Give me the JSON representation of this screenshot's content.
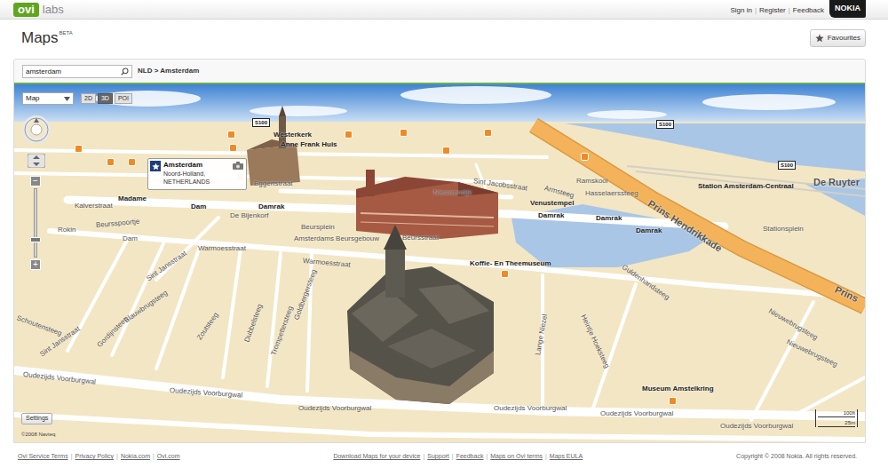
{
  "brand": {
    "logo": "ovi",
    "sub": "labs"
  },
  "account": {
    "links": [
      "Sign in",
      "Register",
      "Feedback"
    ],
    "separator": "|"
  },
  "nokia": "NOKIA",
  "page": {
    "title": "Maps",
    "badge": "BETA"
  },
  "favourites": {
    "label": "Favourites"
  },
  "search": {
    "value": "amsterdam"
  },
  "breadcrumb": "NLD > Amsterdam",
  "map": {
    "view_select": "Map",
    "view_modes": [
      {
        "label": "2D",
        "selected": false
      },
      {
        "label": "3D",
        "selected": true
      },
      {
        "label": "POI",
        "selected": false
      }
    ],
    "zoom": {
      "out": "−",
      "in": "+",
      "level": 0.25
    },
    "popup": {
      "title": "Amsterdam",
      "lines": [
        "Noord-Holland,",
        "NETHERLANDS"
      ]
    },
    "road_shields": [
      "S100",
      "S100",
      "S100"
    ],
    "labels": [
      {
        "text": "Kalverstraat",
        "kind": "street"
      },
      {
        "text": "Madame",
        "kind": "place"
      },
      {
        "text": "Dam",
        "kind": "place"
      },
      {
        "text": "Damrak",
        "kind": "place"
      },
      {
        "text": "De Bijenkorf",
        "kind": "street"
      },
      {
        "text": "Rokin",
        "kind": "street"
      },
      {
        "text": "Beursspoortje",
        "kind": "street"
      },
      {
        "text": "Dam",
        "kind": "street"
      },
      {
        "text": "Beursplein",
        "kind": "street"
      },
      {
        "text": "Amsterdams Beursgebouw",
        "kind": "street"
      },
      {
        "text": "Beursstraat",
        "kind": "street"
      },
      {
        "text": "Warmoesstraat",
        "kind": "street"
      },
      {
        "text": "Warmoesstraat",
        "kind": "street"
      },
      {
        "text": "Sint Jansstraat",
        "kind": "street"
      },
      {
        "text": "Schoutensteeg",
        "kind": "street"
      },
      {
        "text": "Sint Jansstraat",
        "kind": "street"
      },
      {
        "text": "Gordijnsteeg",
        "kind": "street"
      },
      {
        "text": "Blauwbrugsteeg",
        "kind": "street"
      },
      {
        "text": "Zoutsteeg",
        "kind": "street"
      },
      {
        "text": "Dubbelsteeg",
        "kind": "street"
      },
      {
        "text": "Trompettersteeg",
        "kind": "street"
      },
      {
        "text": "Goldbergersteeg",
        "kind": "street"
      },
      {
        "text": "Koffie- En Theemuseum",
        "kind": "place"
      },
      {
        "text": "Guldenhandsteeg",
        "kind": "street"
      },
      {
        "text": "Lange Niezel",
        "kind": "street"
      },
      {
        "text": "Heintje Hoeksteeg",
        "kind": "street"
      },
      {
        "text": "Oudezijds Voorburgwal",
        "kind": "street"
      },
      {
        "text": "Oudezijds Voorburgwal",
        "kind": "street"
      },
      {
        "text": "Oudezijds Voorburgwal",
        "kind": "street"
      },
      {
        "text": "Oudezijds Voorburgwal",
        "kind": "street"
      },
      {
        "text": "Oudezijds Voorburgwal",
        "kind": "street"
      },
      {
        "text": "Oudezijds Voorburgwal",
        "kind": "street"
      },
      {
        "text": "Museum Amstelkring",
        "kind": "place"
      },
      {
        "text": "Nieuwebrugsteeg",
        "kind": "street"
      },
      {
        "text": "Nieuwebrugsteeg",
        "kind": "street"
      },
      {
        "text": "Prins Hendrikkade",
        "kind": "major"
      },
      {
        "text": "Prins",
        "kind": "major"
      },
      {
        "text": "Stationsplein",
        "kind": "street"
      },
      {
        "text": "Station Amsterdam-Centraal",
        "kind": "place"
      },
      {
        "text": "De Ruyter",
        "kind": "major"
      },
      {
        "text": "Venustempel",
        "kind": "place"
      },
      {
        "text": "Damrak",
        "kind": "place"
      },
      {
        "text": "Damrak",
        "kind": "place"
      },
      {
        "text": "Damrak",
        "kind": "place"
      },
      {
        "text": "Nieuwendijk",
        "kind": "street"
      },
      {
        "text": "Sint Jacobsstraat",
        "kind": "street"
      },
      {
        "text": "Armsteeg",
        "kind": "street"
      },
      {
        "text": "Ramskooi",
        "kind": "street"
      },
      {
        "text": "Hasselaerssteeg",
        "kind": "street"
      },
      {
        "text": "Eggertstraat",
        "kind": "street"
      },
      {
        "text": "Westerkerk",
        "kind": "place"
      },
      {
        "text": "Anne Frank Huis",
        "kind": "place"
      }
    ],
    "settings": "Settings",
    "copyright": "©2008 Navteq",
    "scale": [
      "100ft",
      "25m"
    ]
  },
  "footer": {
    "left": [
      "Ovi Service Terms",
      "Privacy Policy",
      "Nokia.com",
      "Ovi.com"
    ],
    "center": [
      "Download Maps for your device",
      "Support",
      "Feedback",
      "Maps on Ovi terms",
      "Maps EULA"
    ],
    "separator": "|",
    "copyright": "Copyright © 2008 Nokia. All rights reserved."
  }
}
